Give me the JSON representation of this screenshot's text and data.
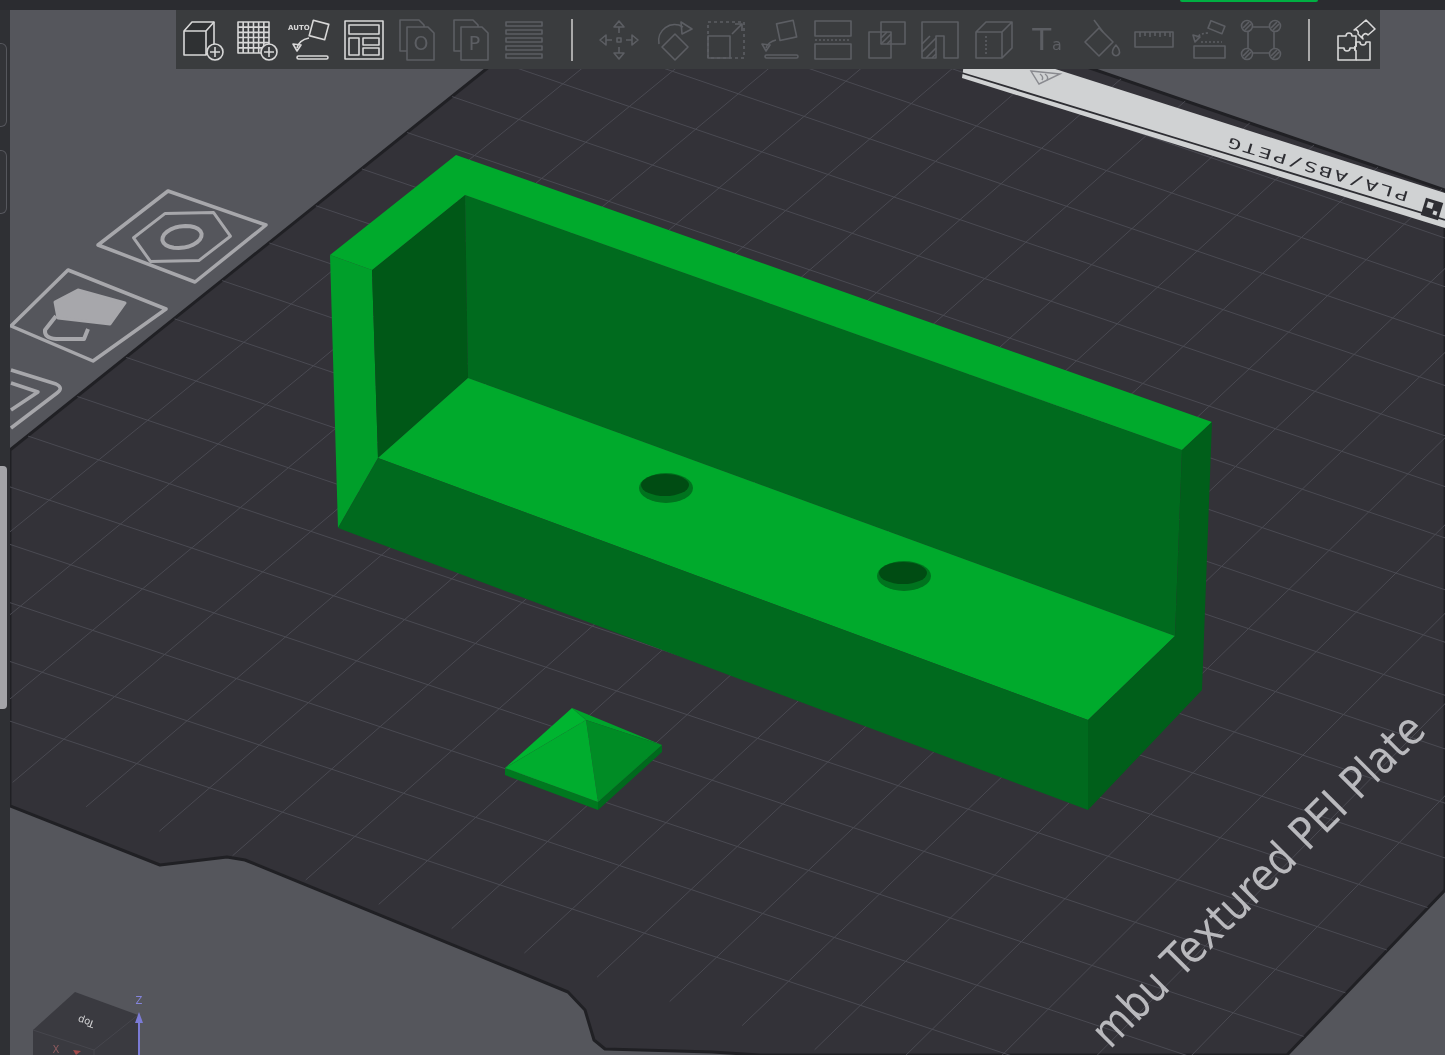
{
  "toolbar": {
    "tools": [
      {
        "kind": "add",
        "disabled": false
      },
      {
        "kind": "plate",
        "disabled": false
      },
      {
        "kind": "orient",
        "glyph": "AUTO",
        "disabled": false
      },
      {
        "kind": "arrange",
        "disabled": false
      },
      {
        "kind": "split",
        "glyph": "O",
        "disabled": true
      },
      {
        "kind": "split",
        "glyph": "P",
        "disabled": true
      },
      {
        "kind": "layers",
        "disabled": true
      },
      {
        "kind": "separator"
      },
      {
        "kind": "move",
        "disabled": true
      },
      {
        "kind": "rotate",
        "disabled": true
      },
      {
        "kind": "scale",
        "disabled": true
      },
      {
        "kind": "lay",
        "disabled": true
      },
      {
        "kind": "cut",
        "disabled": true
      },
      {
        "kind": "boolean",
        "disabled": true
      },
      {
        "kind": "support",
        "disabled": true
      },
      {
        "kind": "seam",
        "disabled": true
      },
      {
        "kind": "text",
        "glyph": "T$_{a}$",
        "disabled": true
      },
      {
        "kind": "paint",
        "disabled": true
      },
      {
        "kind": "measure",
        "disabled": true
      },
      {
        "kind": "drop",
        "disabled": true
      },
      {
        "kind": "ears",
        "disabled": true
      },
      {
        "kind": "separator"
      },
      {
        "kind": "assembly",
        "disabled": false
      }
    ]
  },
  "scene": {
    "plate": {
      "filament_label": "PLA/ABS/PETG",
      "name": "mbu Textured PEI Plate"
    },
    "objects": [
      {
        "kind": "bracket"
      },
      {
        "kind": "pyramid"
      }
    ],
    "view_cube": {
      "face": "Top",
      "z_label": "Z",
      "x_label": "X"
    }
  }
}
